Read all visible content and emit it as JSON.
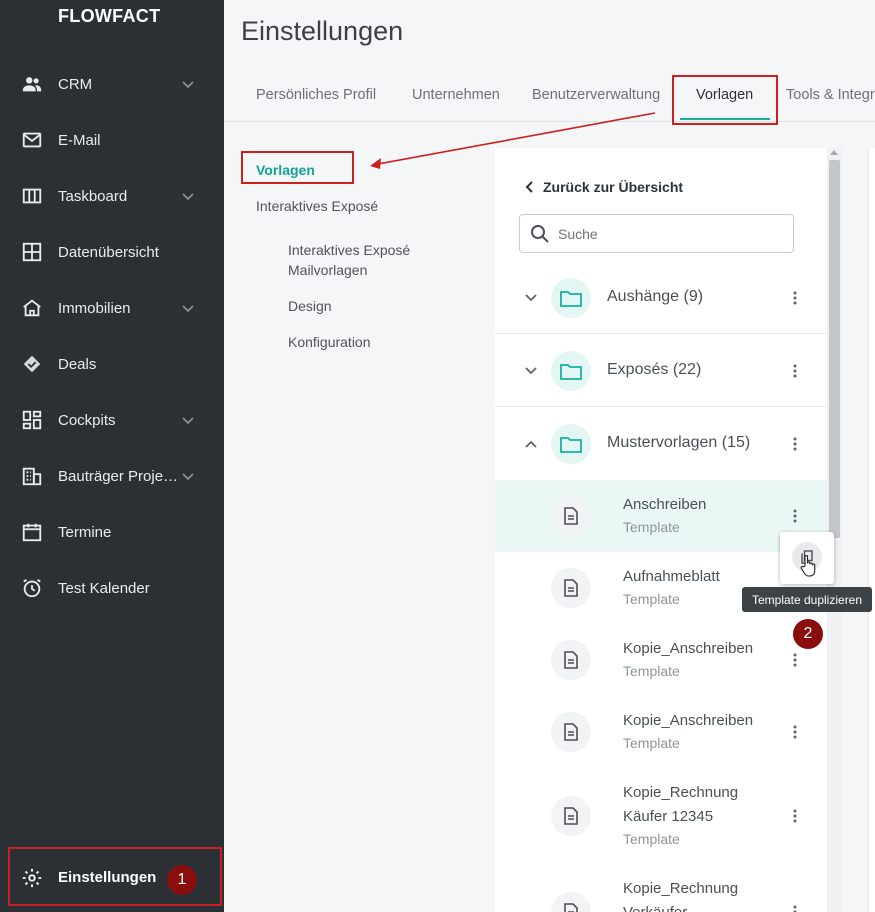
{
  "app": {
    "logo": "FLOWFACT"
  },
  "sidebar": {
    "items": [
      {
        "label": "CRM",
        "icon": "people-icon",
        "has_chevron": true
      },
      {
        "label": "E-Mail",
        "icon": "mail-icon",
        "has_chevron": false
      },
      {
        "label": "Taskboard",
        "icon": "columns-icon",
        "has_chevron": true
      },
      {
        "label": "Datenübersicht",
        "icon": "grid-icon",
        "has_chevron": false
      },
      {
        "label": "Immobilien",
        "icon": "home-icon",
        "has_chevron": true
      },
      {
        "label": "Deals",
        "icon": "handshake-icon",
        "has_chevron": false
      },
      {
        "label": "Cockpits",
        "icon": "dashboard-icon",
        "has_chevron": true
      },
      {
        "label": "Bauträger Proje…",
        "icon": "building-icon",
        "has_chevron": true
      },
      {
        "label": "Termine",
        "icon": "calendar-icon",
        "has_chevron": false
      },
      {
        "label": "Test Kalender",
        "icon": "alarm-icon",
        "has_chevron": false
      }
    ],
    "settings": {
      "label": "Einstellungen",
      "icon": "gear-icon",
      "badge": "1"
    }
  },
  "main": {
    "title": "Einstellungen",
    "tabs": [
      {
        "label": "Persönliches Profil"
      },
      {
        "label": "Unternehmen"
      },
      {
        "label": "Benutzerverwaltung"
      },
      {
        "label": "Vorlagen"
      },
      {
        "label": "Tools & Integr"
      }
    ],
    "subnav": {
      "active": "Vorlagen",
      "items": [
        {
          "label": "Interaktives Exposé"
        },
        {
          "label": "Interaktives Exposé Mailvorlagen"
        },
        {
          "label": "Design"
        },
        {
          "label": "Konfiguration"
        }
      ]
    }
  },
  "panel": {
    "back_label": "Zurück zur Übersicht",
    "search_placeholder": "Suche",
    "folders": [
      {
        "label": "Aushänge (9)",
        "expanded": false
      },
      {
        "label": "Exposés (22)",
        "expanded": false
      },
      {
        "label": "Mustervorlagen (15)",
        "expanded": true
      }
    ],
    "templates": [
      {
        "name": "Anschreiben",
        "type": "Template"
      },
      {
        "name": "Aufnahmeblatt",
        "type": "Template"
      },
      {
        "name": "Kopie_Anschreiben",
        "type": "Template"
      },
      {
        "name": "Kopie_Anschreiben",
        "type": "Template"
      },
      {
        "name": "Kopie_Rechnung Käufer 12345",
        "name_line1": "Kopie_Rechnung",
        "name_line2": "Käufer 12345",
        "type": "Template"
      },
      {
        "name_line1": "Kopie_Rechnung",
        "name_line2": "Verkäufer"
      }
    ]
  },
  "popover": {
    "tooltip": "Template duplizieren",
    "badge": "2",
    "icon": "copy-icon"
  },
  "colors": {
    "sidebar_bg": "#2b3035",
    "accent": "#1ab0a0",
    "highlight": "#cc1f1f",
    "badge": "#8b0e0e"
  }
}
